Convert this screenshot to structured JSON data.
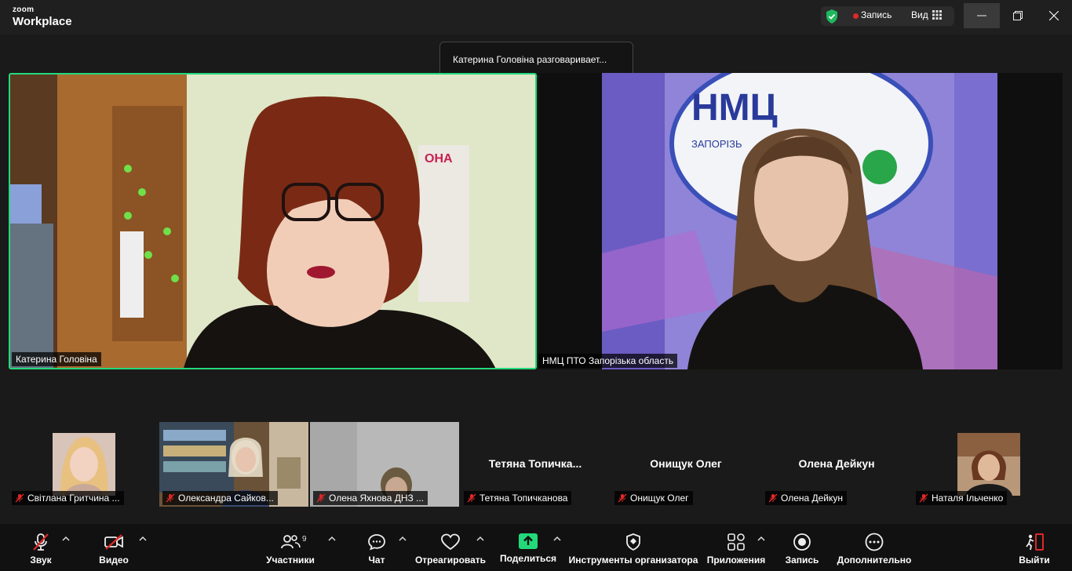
{
  "app": {
    "brand_small": "zoom",
    "brand_large": "Workplace"
  },
  "titlebar": {
    "record_label": "Запись",
    "view_label": "Вид"
  },
  "toast": {
    "text": "Катерина Головіна разговаривает..."
  },
  "main_tiles": [
    {
      "name": "Катерина Головіна"
    },
    {
      "name": "НМЦ ПТО Запорізька область"
    }
  ],
  "thumbnails": [
    {
      "tag": "Світлана Гритчина ...",
      "center_name": ""
    },
    {
      "tag": "Олександра Сайков...",
      "center_name": ""
    },
    {
      "tag": "Олена Яхнова ДНЗ ...",
      "center_name": ""
    },
    {
      "tag": "Тетяна Топичканова",
      "center_name": "Тетяна  Топичка..."
    },
    {
      "tag": "Онищук Олег",
      "center_name": "Онищук Олег"
    },
    {
      "tag": "Олена Дейкун",
      "center_name": "Олена Дейкун"
    },
    {
      "tag": "Наталя Ільченко",
      "center_name": ""
    }
  ],
  "toolbar": {
    "audio": "Звук",
    "video": "Видео",
    "participants": "Участники",
    "participants_count": "9",
    "chat": "Чат",
    "react": "Отреагировать",
    "share": "Поделиться",
    "host_tools": "Инструменты организатора",
    "apps": "Приложения",
    "record": "Запись",
    "more": "Дополнительно",
    "leave": "Выйти"
  },
  "colors": {
    "active_speaker": "#23d97a",
    "share_green": "#23d97a",
    "record_red": "#e02828",
    "leave_red": "#e02828"
  }
}
